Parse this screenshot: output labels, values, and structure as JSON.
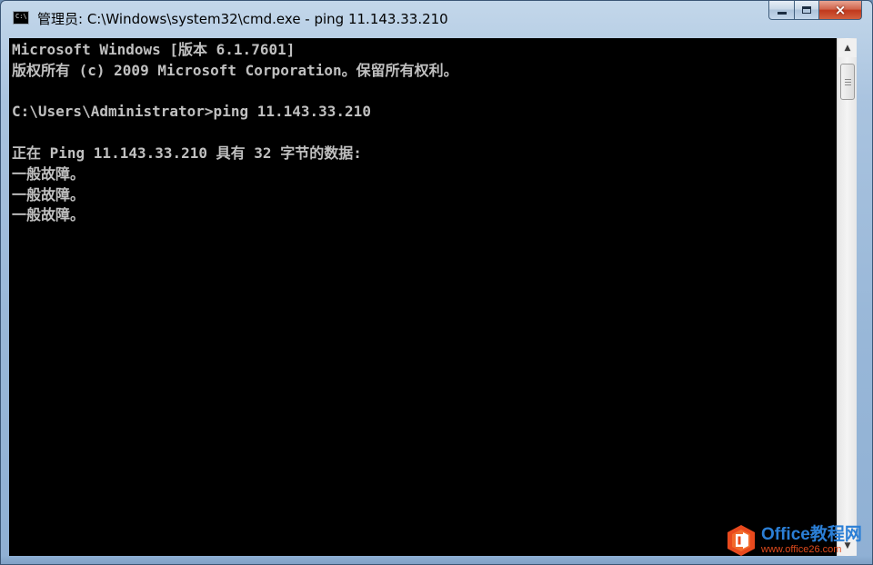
{
  "window": {
    "title": "管理员: C:\\Windows\\system32\\cmd.exe - ping  11.143.33.210",
    "icon_label": "C:\\"
  },
  "caption_buttons": {
    "minimize": "minimize-icon",
    "maximize": "maximize-icon",
    "close": "×"
  },
  "console": {
    "lines": [
      "Microsoft Windows [版本 6.1.7601]",
      "版权所有 (c) 2009 Microsoft Corporation。保留所有权利。",
      "",
      "C:\\Users\\Administrator>ping 11.143.33.210",
      "",
      "正在 Ping 11.143.33.210 具有 32 字节的数据:",
      "一般故障。",
      "一般故障。",
      "一般故障。"
    ]
  },
  "scrollbar": {
    "up_arrow": "▲",
    "down_arrow": "▼"
  },
  "watermark": {
    "brand": "Office教程网",
    "url": "www.office26.com"
  },
  "colors": {
    "console_bg": "#000000",
    "console_text": "#c0c0c0",
    "close_red": "#c0381c",
    "watermark_blue": "#2b7fd6",
    "watermark_orange": "#e04a1c"
  }
}
